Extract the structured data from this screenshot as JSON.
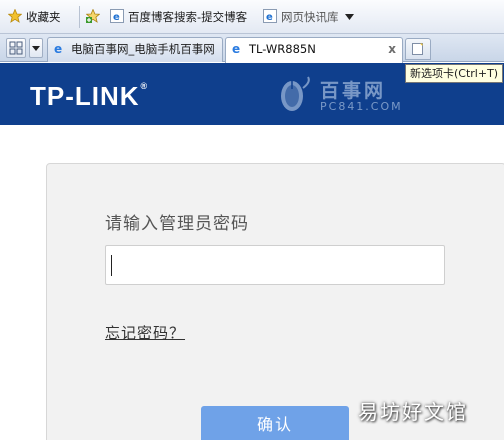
{
  "favorites_bar": {
    "favorites_label": "收藏夹",
    "links": [
      {
        "label": "百度博客搜索-提交博客"
      },
      {
        "label": "网页快讯库"
      }
    ]
  },
  "tabs": [
    {
      "title": "电脑百事网_电脑手机百事网",
      "active": false
    },
    {
      "title": "TL-WR885N",
      "active": true,
      "close": "x"
    }
  ],
  "new_tab_tooltip": "新选项卡(Ctrl+T)",
  "header": {
    "brand": "TP-LINK",
    "brand_mark": "®",
    "watermark_cn": "百事网",
    "watermark_en": "PC841.COM",
    "bg_color": "#0f3f8d"
  },
  "login": {
    "prompt": "请输入管理员密码",
    "password_value": "",
    "forgot_link": "忘记密码？",
    "confirm_label": "确认",
    "accent_color": "#6fa2e8"
  },
  "site_watermark": "易坊好文馆",
  "icons": [
    "favorites-star-icon",
    "add-favorite-icon",
    "ie-page-icon",
    "quick-tabs-icon",
    "dropdown-arrow-icon",
    "new-tab-icon",
    "mouse-logo-icon"
  ]
}
